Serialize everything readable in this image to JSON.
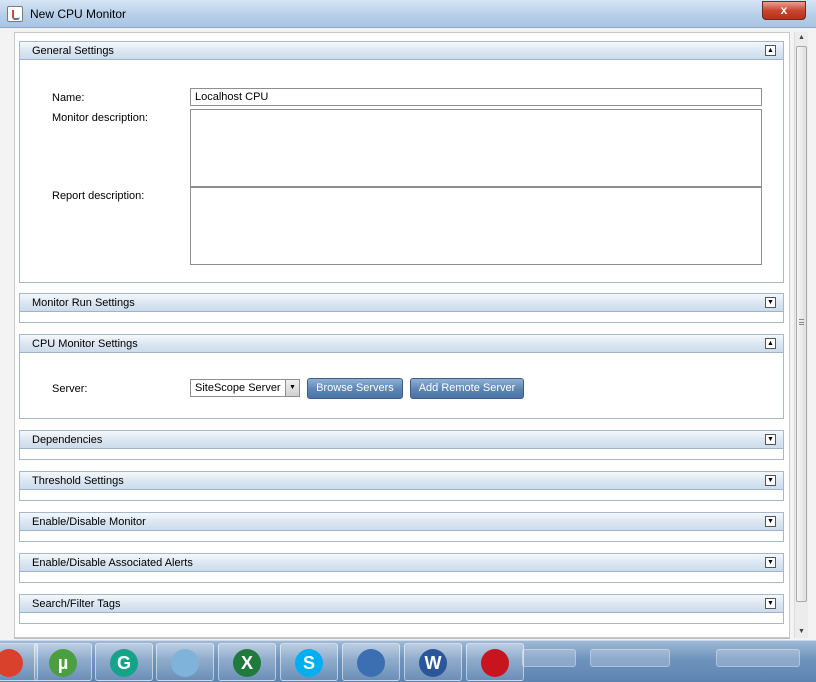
{
  "window": {
    "title": "New CPU Monitor",
    "close_label": "x"
  },
  "panels": {
    "general": {
      "title": "General Settings",
      "toggle": "▲",
      "name_label": "Name:",
      "name_value": "Localhost CPU",
      "monitor_desc_label": "Monitor description:",
      "monitor_desc_value": "",
      "report_desc_label": "Report description:",
      "report_desc_value": ""
    },
    "run": {
      "title": "Monitor Run Settings",
      "toggle": "▼"
    },
    "cpu": {
      "title": "CPU Monitor Settings",
      "toggle": "▲",
      "server_label": "Server:",
      "server_value": "SiteScope Server",
      "browse_label": "Browse Servers",
      "add_remote_label": "Add Remote Server"
    },
    "dependencies": {
      "title": "Dependencies",
      "toggle": "▼"
    },
    "threshold": {
      "title": "Threshold Settings",
      "toggle": "▼"
    },
    "enable_monitor": {
      "title": "Enable/Disable Monitor",
      "toggle": "▼"
    },
    "enable_alerts": {
      "title": "Enable/Disable Associated Alerts",
      "toggle": "▼"
    },
    "tags": {
      "title": "Search/Filter Tags",
      "toggle": "▼"
    }
  },
  "scrollbar": {
    "up": "▲",
    "down": "▼"
  },
  "taskbar": {
    "apps": [
      {
        "name": "chrome-icon",
        "glyph": "",
        "color": "#d9412c"
      },
      {
        "name": "utorrent-icon",
        "glyph": "µ",
        "color": "#4aa03f"
      },
      {
        "name": "grammarly-icon",
        "glyph": "G",
        "color": "#15a48a"
      },
      {
        "name": "notepad-icon",
        "glyph": "",
        "color": "#7fb3d9"
      },
      {
        "name": "excel-icon",
        "glyph": "X",
        "color": "#1f7a3b"
      },
      {
        "name": "skype-icon",
        "glyph": "S",
        "color": "#00aff0"
      },
      {
        "name": "remote-desktop-icon",
        "glyph": "",
        "color": "#3b6fb1"
      },
      {
        "name": "word-icon",
        "glyph": "W",
        "color": "#2b579a"
      },
      {
        "name": "acrobat-icon",
        "glyph": "",
        "color": "#c8141d"
      }
    ]
  }
}
